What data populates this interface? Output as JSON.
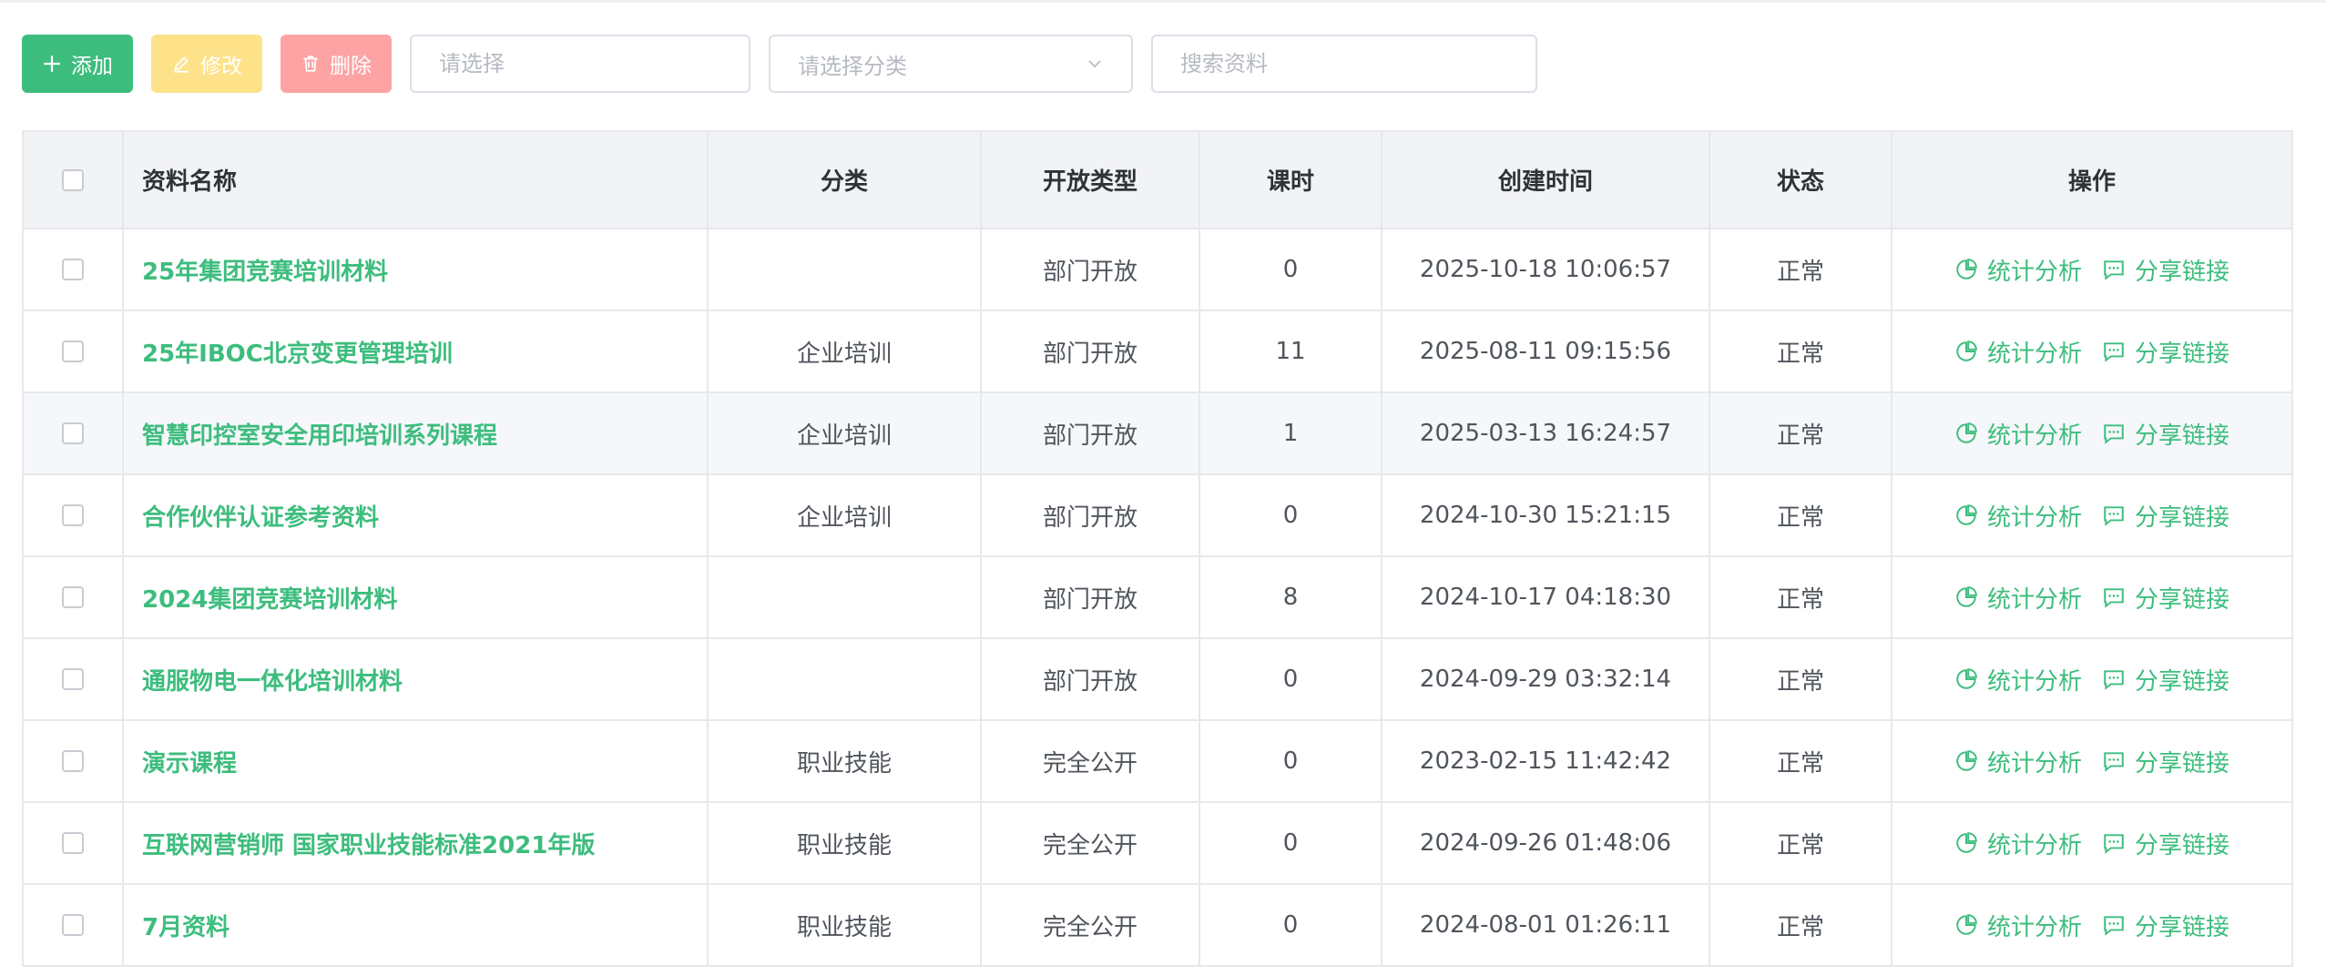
{
  "toolbar": {
    "add_label": "添加",
    "edit_label": "修改",
    "delete_label": "删除",
    "select_placeholder": "请选择",
    "category_placeholder": "请选择分类",
    "search_placeholder": "搜索资料"
  },
  "table": {
    "headers": {
      "name": "资料名称",
      "category": "分类",
      "open_type": "开放类型",
      "hours": "课时",
      "created": "创建时间",
      "status": "状态",
      "actions": "操作"
    },
    "action_stats": "统计分析",
    "action_share": "分享链接",
    "rows": [
      {
        "name": "25年集团竞赛培训材料",
        "category": "",
        "open_type": "部门开放",
        "hours": "0",
        "created": "2025-10-18 10:06:57",
        "status": "正常"
      },
      {
        "name": "25年IBOC北京变更管理培训",
        "category": "企业培训",
        "open_type": "部门开放",
        "hours": "11",
        "created": "2025-08-11 09:15:56",
        "status": "正常"
      },
      {
        "name": "智慧印控室安全用印培训系列课程",
        "category": "企业培训",
        "open_type": "部门开放",
        "hours": "1",
        "created": "2025-03-13 16:24:57",
        "status": "正常"
      },
      {
        "name": "合作伙伴认证参考资料",
        "category": "企业培训",
        "open_type": "部门开放",
        "hours": "0",
        "created": "2024-10-30 15:21:15",
        "status": "正常"
      },
      {
        "name": "2024集团竞赛培训材料",
        "category": "",
        "open_type": "部门开放",
        "hours": "8",
        "created": "2024-10-17 04:18:30",
        "status": "正常"
      },
      {
        "name": "通服物电一体化培训材料",
        "category": "",
        "open_type": "部门开放",
        "hours": "0",
        "created": "2024-09-29 03:32:14",
        "status": "正常"
      },
      {
        "name": "演示课程",
        "category": "职业技能",
        "open_type": "完全公开",
        "hours": "0",
        "created": "2023-02-15 11:42:42",
        "status": "正常"
      },
      {
        "name": "互联网营销师 国家职业技能标准2021年版",
        "category": "职业技能",
        "open_type": "完全公开",
        "hours": "0",
        "created": "2024-09-26 01:48:06",
        "status": "正常"
      },
      {
        "name": "7月资料",
        "category": "职业技能",
        "open_type": "完全公开",
        "hours": "0",
        "created": "2024-08-01 01:26:11",
        "status": "正常"
      }
    ]
  },
  "colors": {
    "primary": "#3dbd7d",
    "edit": "#fde28a",
    "delete": "#fda3a3"
  },
  "icons": {
    "add": "plus-icon",
    "edit": "pencil-icon",
    "delete": "trash-icon",
    "select": "chevron-down-icon",
    "stats": "pie-chart-icon",
    "share": "message-icon"
  }
}
